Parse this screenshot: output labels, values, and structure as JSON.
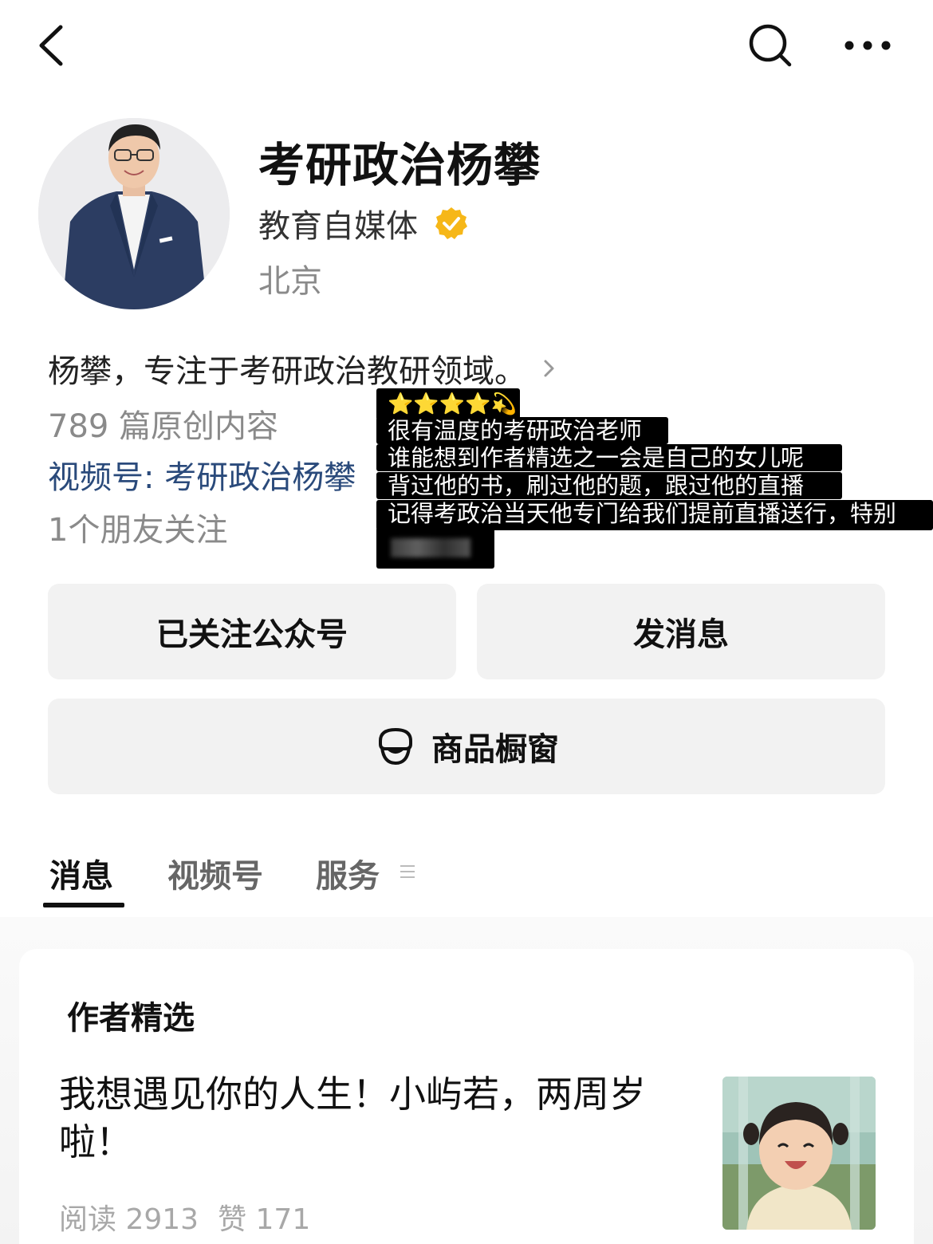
{
  "header": {
    "back_icon": "chevron-left-icon",
    "search_icon": "search-icon",
    "more_icon": "more-horizontal-icon"
  },
  "profile": {
    "name": "考研政治杨攀",
    "category": "教育自媒体",
    "verified_color": "#F6B718",
    "location": "北京",
    "bio": "杨攀，专注于考研政治教研领域。",
    "original_count": "789 篇原创内容",
    "channel_link": "视频号: 考研政治杨攀",
    "friends_following": "1个朋友关注"
  },
  "overlay": {
    "stars": "⭐⭐⭐⭐💫",
    "lines": [
      "很有温度的考研政治老师",
      "谁能想到作者精选之一会是自己的女儿呢",
      "背过他的书，刷过他的题，跟过他的直播",
      "记得考政治当天他专门给我们提前直播送行，特别"
    ]
  },
  "actions": {
    "follow_label": "已关注公众号",
    "message_label": "发消息",
    "shop_label": "商品橱窗",
    "shop_icon": "shop-window-icon"
  },
  "tabs": [
    {
      "label": "消息",
      "active": true
    },
    {
      "label": "视频号",
      "active": false
    },
    {
      "label": "服务",
      "active": false
    }
  ],
  "featured": {
    "title": "作者精选",
    "article": {
      "title": "我想遇见你的人生！小屿若，两周岁啦！",
      "reads": "阅读 2913",
      "likes": "赞 171"
    }
  },
  "colors": {
    "link": "#2A4A7B",
    "button_bg": "#F2F2F2",
    "muted": "#8A8A8A"
  }
}
